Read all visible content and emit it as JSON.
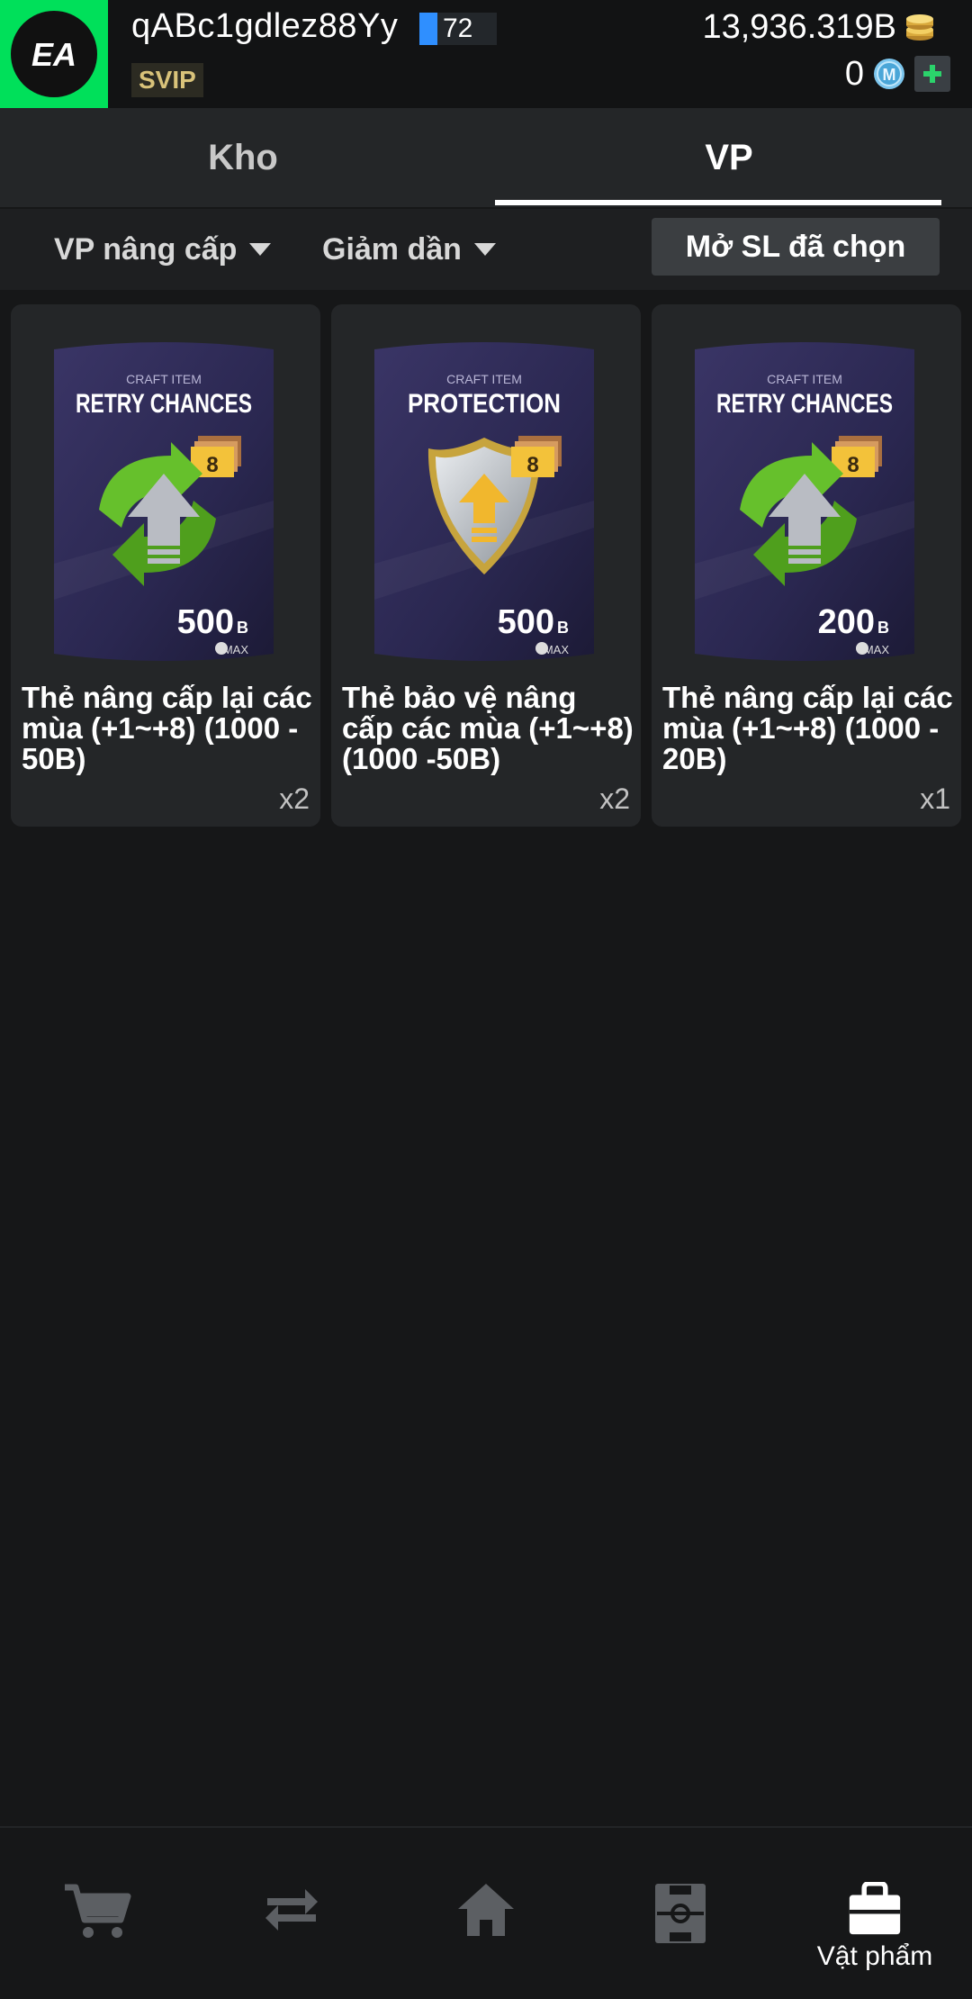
{
  "header": {
    "username": "qABc1gdlez88Yy",
    "level": "72",
    "vip_label": "SVIP",
    "coins": "13,936.319B",
    "m_coins": "0",
    "logo_text": "EA"
  },
  "tabs": [
    {
      "label": "Kho",
      "active": false
    },
    {
      "label": "VP",
      "active": true
    }
  ],
  "filters": {
    "category": "VP nâng cấp",
    "sort": "Giảm dần",
    "open_selected": "Mở SL đã chọn"
  },
  "items": [
    {
      "art_top": "CRAFT ITEM",
      "art_title": "RETRY CHANCES",
      "badge": "8",
      "value": "500",
      "unit": "B",
      "max_label": "MAX",
      "name": "Thẻ nâng cấp lại các mùa (+1~+8) (1000 - 50B)",
      "qty": "x2"
    },
    {
      "art_top": "CRAFT ITEM",
      "art_title": "PROTECTION",
      "badge": "8",
      "value": "500",
      "unit": "B",
      "max_label": "MAX",
      "name": "Thẻ bảo vệ nâng cấp các mùa (+1~+8) (1000 -50B)",
      "qty": "x2"
    },
    {
      "art_top": "CRAFT ITEM",
      "art_title": "RETRY CHANCES",
      "badge": "8",
      "value": "200",
      "unit": "B",
      "max_label": "MAX",
      "name": "Thẻ nâng cấp lại các mùa (+1~+8) (1000 - 20B)",
      "qty": "x1"
    }
  ],
  "bottom_nav": [
    {
      "icon": "cart-icon",
      "label": ""
    },
    {
      "icon": "transfer-icon",
      "label": ""
    },
    {
      "icon": "home-icon",
      "label": ""
    },
    {
      "icon": "pitch-icon",
      "label": ""
    },
    {
      "icon": "bag-icon",
      "label": "Vật phẩm"
    }
  ],
  "colors": {
    "accent_green": "#00e05a",
    "level_blue": "#2f8fff",
    "card_bg": "#242628",
    "page_bg": "#161718"
  }
}
